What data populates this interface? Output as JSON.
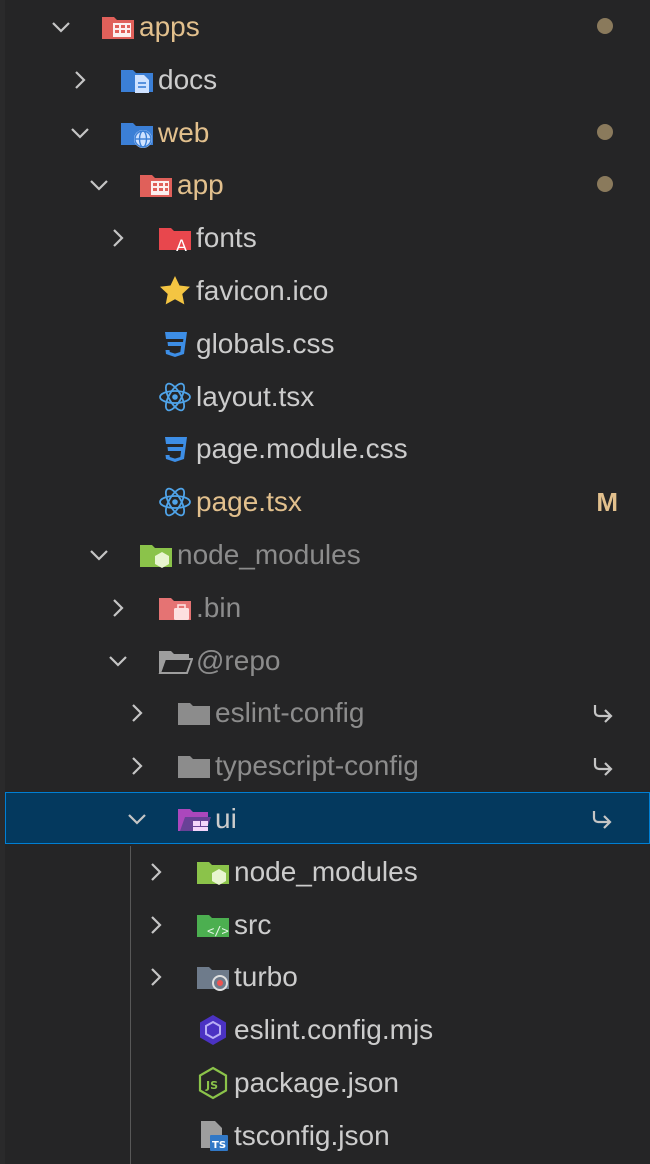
{
  "explorer": {
    "items": [
      {
        "label": "apps",
        "depth": 0,
        "kind": "folder",
        "expanded": true,
        "icon": "apps-folder-icon",
        "status": "dot",
        "label_style": "folder-changed"
      },
      {
        "label": "docs",
        "depth": 1,
        "kind": "folder",
        "expanded": false,
        "icon": "docs-folder-icon",
        "status": "",
        "label_style": "normal"
      },
      {
        "label": "web",
        "depth": 1,
        "kind": "folder",
        "expanded": true,
        "icon": "web-folder-icon",
        "status": "dot",
        "label_style": "folder-changed"
      },
      {
        "label": "app",
        "depth": 2,
        "kind": "folder",
        "expanded": true,
        "icon": "app-folder-icon",
        "status": "dot",
        "label_style": "folder-changed"
      },
      {
        "label": "fonts",
        "depth": 3,
        "kind": "folder",
        "expanded": false,
        "icon": "fonts-folder-icon",
        "status": "",
        "label_style": "normal"
      },
      {
        "label": "favicon.ico",
        "depth": 3,
        "kind": "file",
        "icon": "favicon-star-icon",
        "status": "",
        "label_style": "normal"
      },
      {
        "label": "globals.css",
        "depth": 3,
        "kind": "file",
        "icon": "css-icon",
        "status": "",
        "label_style": "normal"
      },
      {
        "label": "layout.tsx",
        "depth": 3,
        "kind": "file",
        "icon": "react-icon",
        "status": "",
        "label_style": "normal"
      },
      {
        "label": "page.module.css",
        "depth": 3,
        "kind": "file",
        "icon": "css-icon",
        "status": "",
        "label_style": "normal"
      },
      {
        "label": "page.tsx",
        "depth": 3,
        "kind": "file",
        "icon": "react-icon",
        "status": "M",
        "label_style": "modified"
      },
      {
        "label": "node_modules",
        "depth": 2,
        "kind": "folder",
        "expanded": true,
        "icon": "node-modules-folder-icon",
        "status": "",
        "label_style": "dim"
      },
      {
        "label": ".bin",
        "depth": 3,
        "kind": "folder",
        "expanded": false,
        "icon": "bin-folder-icon",
        "status": "",
        "label_style": "dim"
      },
      {
        "label": "@repo",
        "depth": 3,
        "kind": "folder",
        "expanded": true,
        "icon": "open-folder-icon",
        "status": "",
        "label_style": "dim"
      },
      {
        "label": "eslint-config",
        "depth": 4,
        "kind": "folder",
        "expanded": false,
        "icon": "gray-folder-icon",
        "status": "link",
        "label_style": "dim"
      },
      {
        "label": "typescript-config",
        "depth": 4,
        "kind": "folder",
        "expanded": false,
        "icon": "gray-folder-icon",
        "status": "link",
        "label_style": "dim"
      },
      {
        "label": "ui",
        "depth": 4,
        "kind": "folder",
        "expanded": true,
        "icon": "ui-folder-icon",
        "status": "link",
        "label_style": "normal",
        "selected": true
      },
      {
        "label": "node_modules",
        "depth": 5,
        "kind": "folder",
        "expanded": false,
        "icon": "node-modules-folder-icon",
        "status": "",
        "label_style": "normal"
      },
      {
        "label": "src",
        "depth": 5,
        "kind": "folder",
        "expanded": false,
        "icon": "src-folder-icon",
        "status": "",
        "label_style": "normal"
      },
      {
        "label": "turbo",
        "depth": 5,
        "kind": "folder",
        "expanded": false,
        "icon": "turbo-folder-icon",
        "status": "",
        "label_style": "normal"
      },
      {
        "label": "eslint.config.mjs",
        "depth": 5,
        "kind": "file",
        "icon": "eslint-icon",
        "status": "",
        "label_style": "normal"
      },
      {
        "label": "package.json",
        "depth": 5,
        "kind": "file",
        "icon": "nodejs-icon",
        "status": "",
        "label_style": "normal"
      },
      {
        "label": "tsconfig.json",
        "depth": 5,
        "kind": "file",
        "icon": "tsconfig-icon",
        "status": "",
        "label_style": "normal"
      }
    ]
  },
  "colors": {
    "background": "#252526",
    "selection": "#04395e",
    "selection_border": "#007fd4",
    "modified": "#e2c08d",
    "text": "#cccccc",
    "dim_text": "#8c8c8c"
  }
}
